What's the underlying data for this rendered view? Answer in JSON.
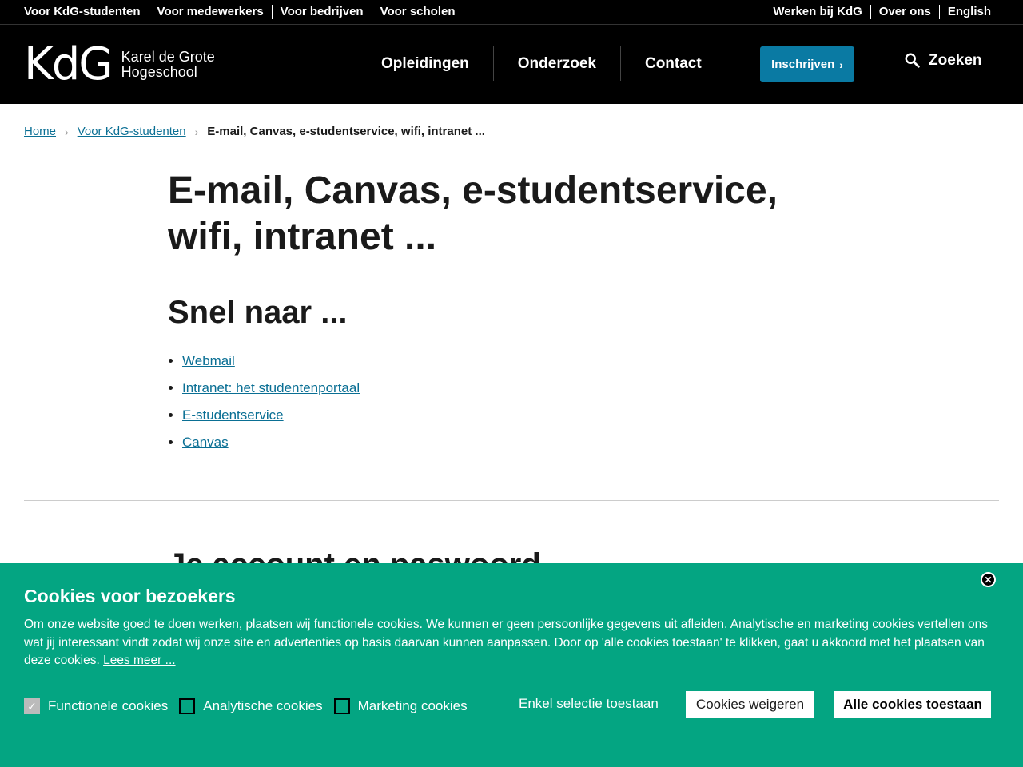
{
  "topbar": {
    "left": [
      "Voor KdG-studenten",
      "Voor medewerkers",
      "Voor bedrijven",
      "Voor scholen"
    ],
    "right": [
      "Werken bij KdG",
      "Over ons",
      "English"
    ]
  },
  "header": {
    "logo_mark": "KdG",
    "logo_line1": "Karel de Grote",
    "logo_line2": "Hogeschool",
    "nav": [
      "Opleidingen",
      "Onderzoek",
      "Contact"
    ],
    "cta": "Inschrijven",
    "search_label": "Zoeken"
  },
  "breadcrumb": {
    "home": "Home",
    "parent": "Voor KdG-studenten",
    "current": "E-mail, Canvas, e-studentservice, wifi, intranet ..."
  },
  "main": {
    "title": "E-mail, Canvas, e-studentservice, wifi, intranet ...",
    "quick_heading": "Snel naar ...",
    "quick_links": [
      "Webmail",
      "Intranet: het studentenportaal",
      "E-studentservice",
      "Canvas"
    ],
    "account_heading": "Je account en paswoord"
  },
  "cookies": {
    "title": "Cookies voor bezoekers",
    "body": "Om onze website goed te doen werken, plaatsen wij functionele cookies. We kunnen er geen persoonlijke gegevens uit afleiden. Analytische en marketing cookies vertellen ons wat jij interessant vindt zodat wij onze site en advertenties op basis daarvan kunnen aanpassen. Door op 'alle cookies toestaan' te klikken, gaat u akkoord met het plaatsen van deze cookies.",
    "more_link": "Lees meer ...",
    "options": [
      {
        "label": "Functionele cookies",
        "checked": true
      },
      {
        "label": "Analytische cookies",
        "checked": false
      },
      {
        "label": "Marketing cookies",
        "checked": false
      }
    ],
    "selection_link": "Enkel selectie toestaan",
    "refuse_button": "Cookies weigeren",
    "accept_button": "Alle cookies toestaan",
    "close_label": "✕"
  },
  "colors": {
    "accent": "#0a7aa3",
    "banner": "#04a582",
    "link": "#0a6f94"
  }
}
